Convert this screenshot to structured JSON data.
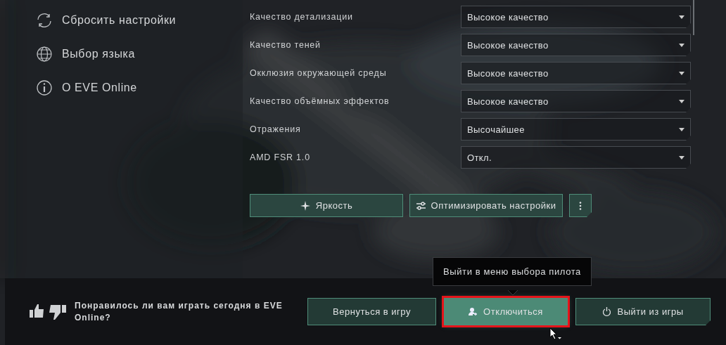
{
  "sidebar": {
    "items": [
      {
        "label": "Сбросить настройки"
      },
      {
        "label": "Выбор языка"
      },
      {
        "label": "О EVE Online"
      }
    ]
  },
  "settings": {
    "rows": [
      {
        "label": "Качество детализации",
        "value": "Высокое качество"
      },
      {
        "label": "Качество теней",
        "value": "Высокое качество"
      },
      {
        "label": "Окклюзия окружающей среды",
        "value": "Высокое качество"
      },
      {
        "label": "Качество объёмных эффектов",
        "value": "Высокое качество"
      },
      {
        "label": "Отражения",
        "value": "Высочайшее"
      },
      {
        "label": "AMD FSR 1.0",
        "value": "Откл."
      }
    ],
    "actions": [
      {
        "label": "Яркость"
      },
      {
        "label": "Оптимизировать настройки"
      }
    ]
  },
  "footer": {
    "feedback": "Понравилось ли вам играть сегодня в EVE Online?",
    "buttons": [
      {
        "label": "Вернуться в игру",
        "selected": false
      },
      {
        "label": "Отключиться",
        "selected": true
      },
      {
        "label": "Выйти из игры",
        "selected": false
      }
    ],
    "tooltip": "Выйти в меню выбора пилота"
  }
}
